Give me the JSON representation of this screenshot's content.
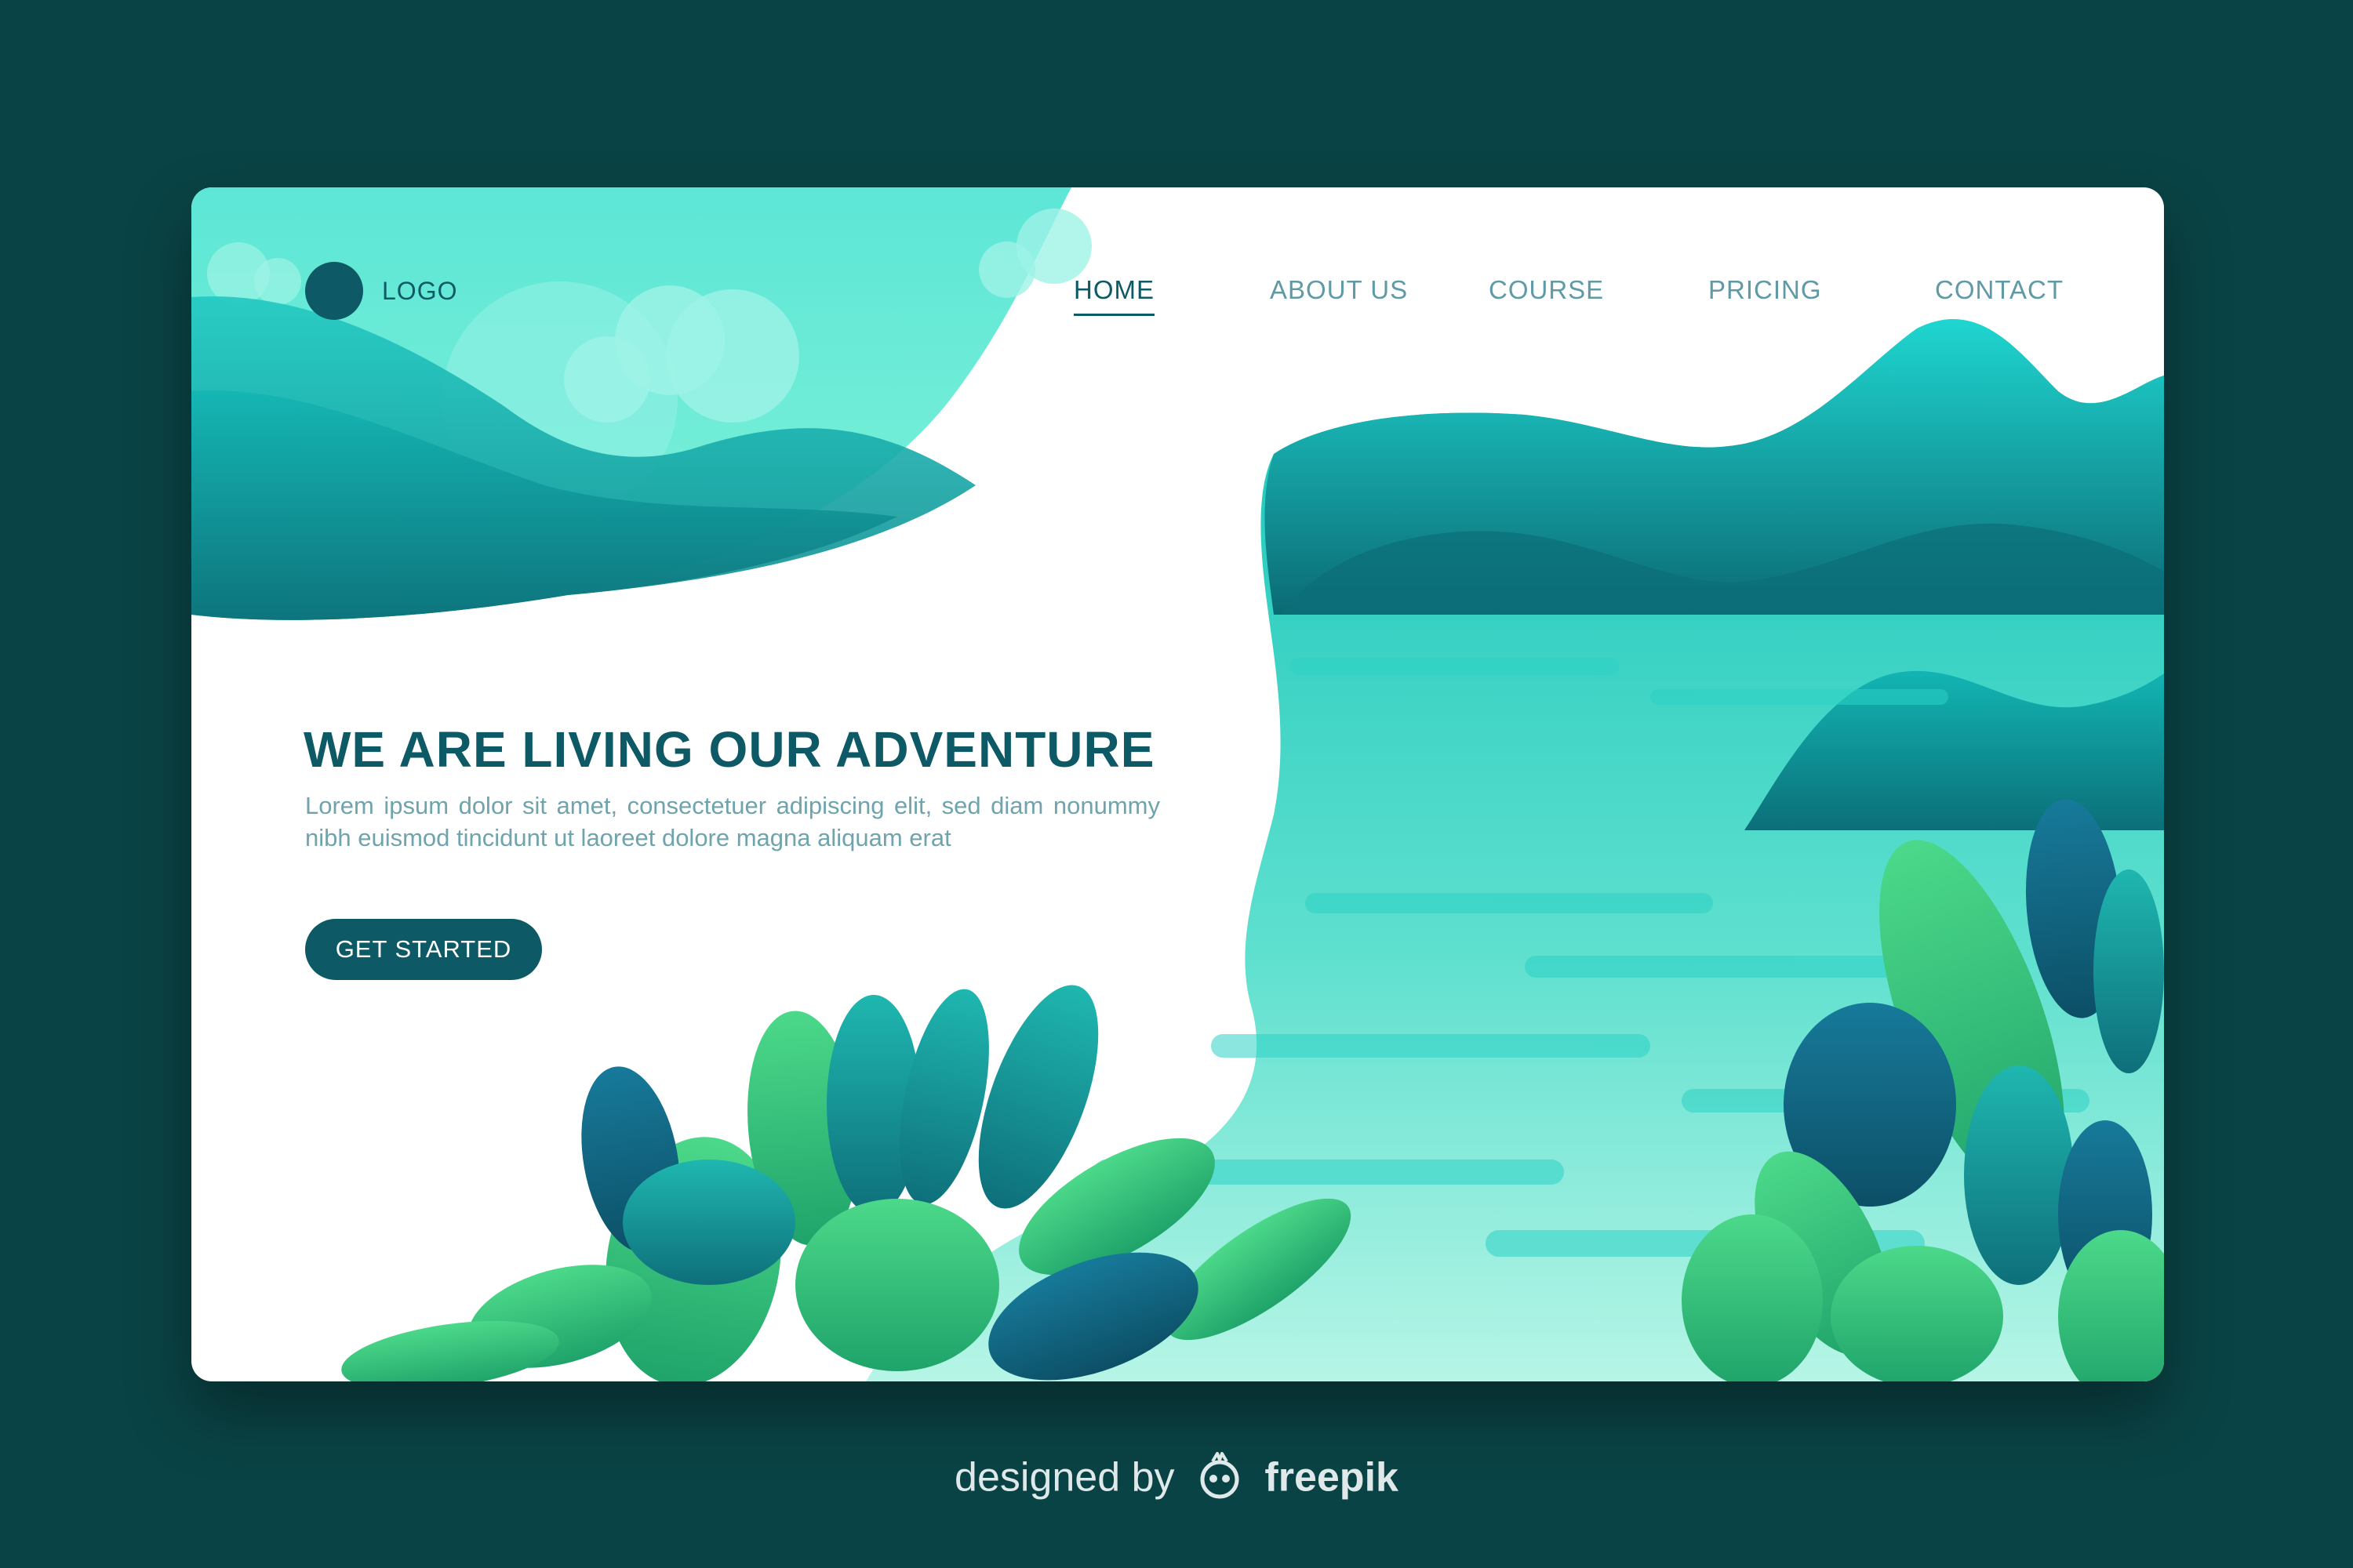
{
  "logo": {
    "text": "LOGO"
  },
  "nav": {
    "items": [
      {
        "label": "HOME",
        "active": true
      },
      {
        "label": "ABOUT US",
        "active": false
      },
      {
        "label": "COURSE",
        "active": false
      },
      {
        "label": "PRICING",
        "active": false
      },
      {
        "label": "CONTACT",
        "active": false
      }
    ]
  },
  "hero": {
    "headline": "WE ARE LIVING OUR ADVENTURE",
    "body": "Lorem ipsum dolor sit amet, consectetuer adipiscing elit, sed diam nonummy nibh euismod tincidunt ut laoreet dolore magna aliquam erat",
    "cta_label": "GET STARTED"
  },
  "footer": {
    "prefix": "designed by",
    "brand": "freepik"
  },
  "colors": {
    "page_background": "#0a4345",
    "card_background": "#ffffff",
    "primary": "#0d5a66",
    "nav_inactive": "#5f9aa6",
    "body_text": "#6fa4ad",
    "teal_light": "#5de6cf",
    "teal_dark": "#0f8a8a",
    "leaf_green": "#3ecf7a"
  }
}
